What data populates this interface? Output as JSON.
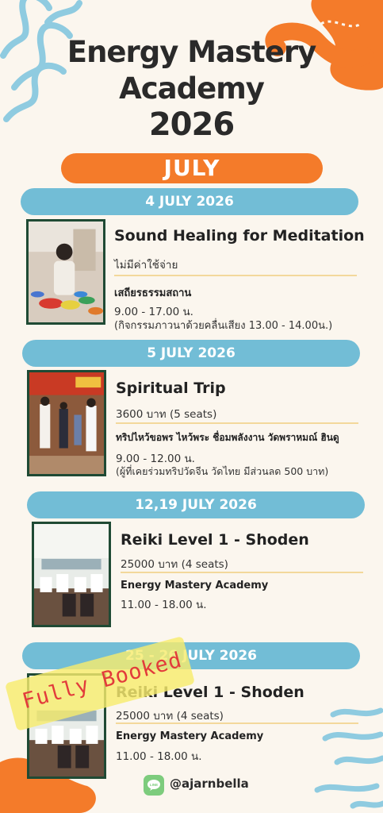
{
  "header": {
    "title_line1": "Energy Mastery",
    "title_line2": "Academy",
    "title_line3": "2026",
    "month": "JULY"
  },
  "events": [
    {
      "date": "4 JULY 2026",
      "title": "Sound Healing for Meditation",
      "price": "ไม่มีค่าใช้จ่าย",
      "venue": "เสถียรธรรมสถาน",
      "time": "9.00 - 17.00 น.",
      "note": "(กิจกรรมภาวนาด้วยคลื่นเสียง 13.00 - 14.00น.)"
    },
    {
      "date": "5 JULY 2026",
      "title": "Spiritual Trip",
      "price": "3600 บาท   (5 seats)",
      "venue": "ทริปไหว้ขอพร ไหว้พระ ชื่อมพลังงาน วัดพราหมณ์ ฮินดู",
      "time": "9.00 - 12.00 น.",
      "note": "(ผู้ที่เคยร่วมทริปวัดจีน วัดไทย มีส่วนลด 500 บาท)"
    },
    {
      "date": "12,19  JULY 2026",
      "title": "Reiki Level 1 - Shoden",
      "price": "25000 บาท  (4 seats)",
      "venue": "Energy Mastery Academy",
      "time": "11.00 - 18.00 น."
    },
    {
      "date": "25 - 26  JULY 2026",
      "title": "Reiki Level 1 - Shoden",
      "price": "25000 บาท  (4 seats)",
      "venue": "Energy Mastery Academy",
      "time": "11.00 - 18.00 น.",
      "status": "Fully Booked"
    }
  ],
  "footer": {
    "line_icon_label": "LINE",
    "handle": "@ajarnbella"
  },
  "colors": {
    "accent_orange": "#f47b2a",
    "date_bar_blue": "#72bdd6",
    "photo_border": "#1f4a34",
    "background": "#fbf6ee",
    "stamp_yellow": "#f6ec6e",
    "stamp_red": "#e23b3b"
  }
}
